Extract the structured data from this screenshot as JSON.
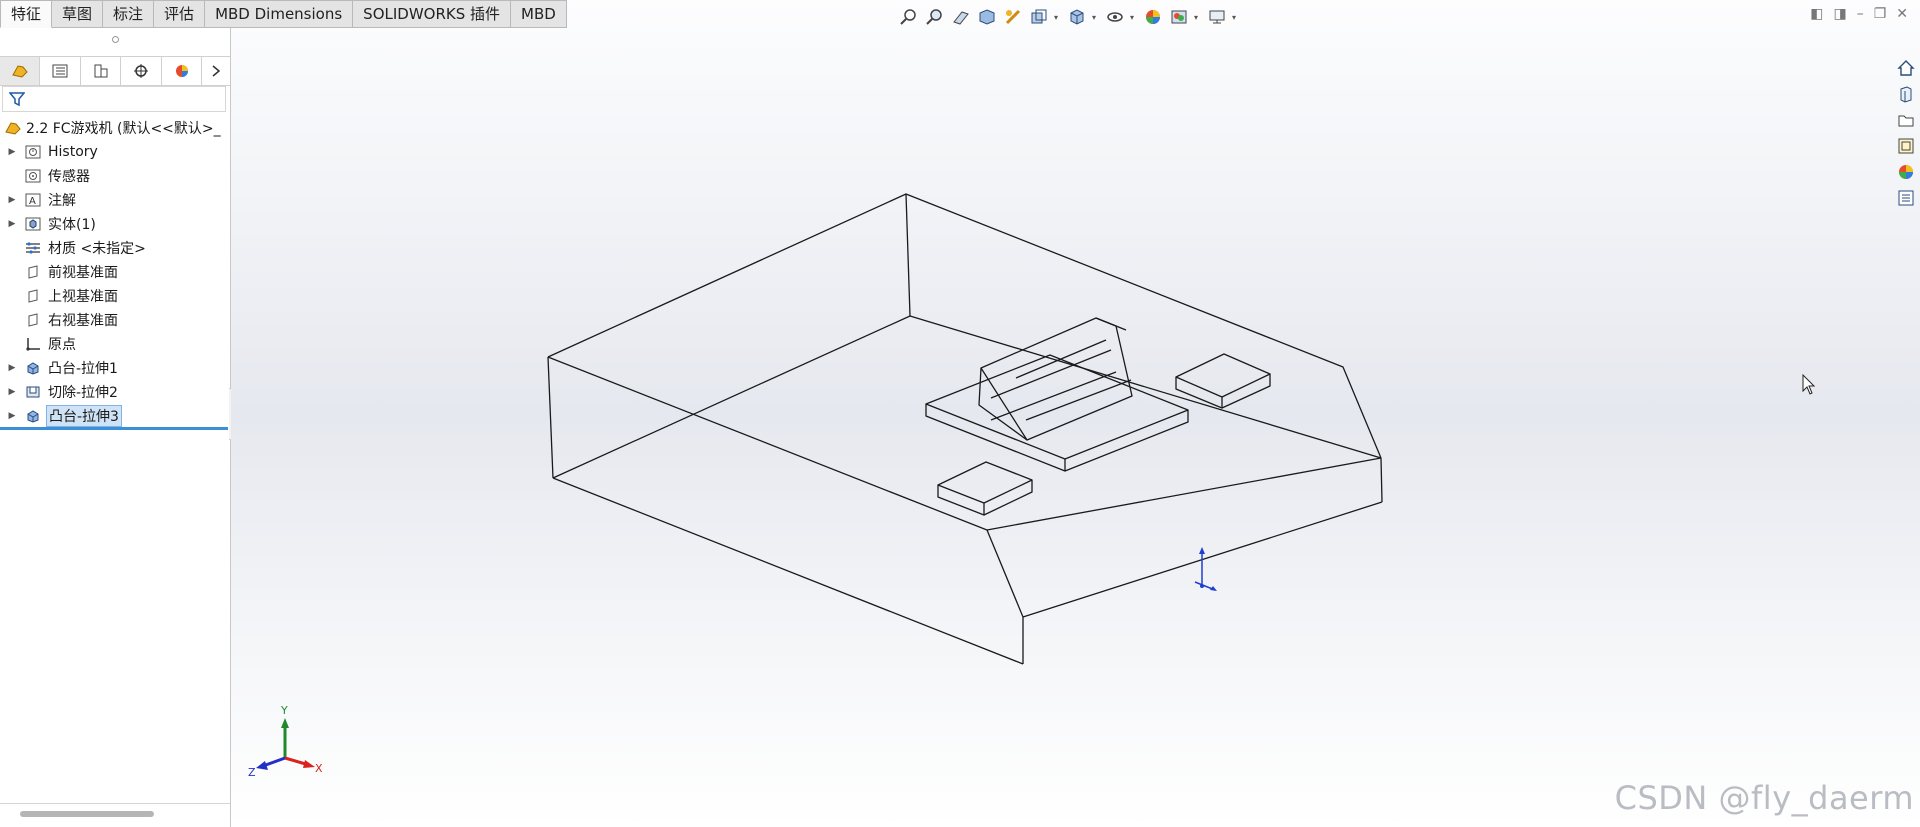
{
  "tabs": [
    "特征",
    "草图",
    "标注",
    "评估",
    "MBD Dimensions",
    "SOLIDWORKS 插件",
    "MBD"
  ],
  "feature_tree": {
    "root_label": "2.2 FC游戏机  (默认<<默认>_",
    "items": [
      {
        "label": "History",
        "icon": "history-folder-icon",
        "expandable": true
      },
      {
        "label": "传感器",
        "icon": "sensors-icon",
        "expandable": false
      },
      {
        "label": "注解",
        "icon": "annotations-icon",
        "expandable": true
      },
      {
        "label": "实体(1)",
        "icon": "solid-bodies-icon",
        "expandable": true
      },
      {
        "label": "材质 <未指定>",
        "icon": "material-icon",
        "expandable": false
      },
      {
        "label": "前视基准面",
        "icon": "plane-icon",
        "expandable": false
      },
      {
        "label": "上视基准面",
        "icon": "plane-icon",
        "expandable": false
      },
      {
        "label": "右视基准面",
        "icon": "plane-icon",
        "expandable": false
      },
      {
        "label": "原点",
        "icon": "origin-icon",
        "expandable": false
      },
      {
        "label": "凸台-拉伸1",
        "icon": "boss-extrude-icon",
        "expandable": true
      },
      {
        "label": "切除-拉伸2",
        "icon": "cut-extrude-icon",
        "expandable": true
      },
      {
        "label": "凸台-拉伸3",
        "icon": "boss-extrude-icon",
        "expandable": true,
        "selected": true
      }
    ]
  },
  "triad": {
    "x": "X",
    "y": "Y",
    "z": "Z"
  },
  "watermark": "CSDN @fly_daerm",
  "colors": {
    "accent": "#3a8fd6",
    "selection": "#cfe3f7",
    "x_axis": "#d9231f",
    "y_axis": "#1f8a2b",
    "z_axis": "#2230c8"
  }
}
